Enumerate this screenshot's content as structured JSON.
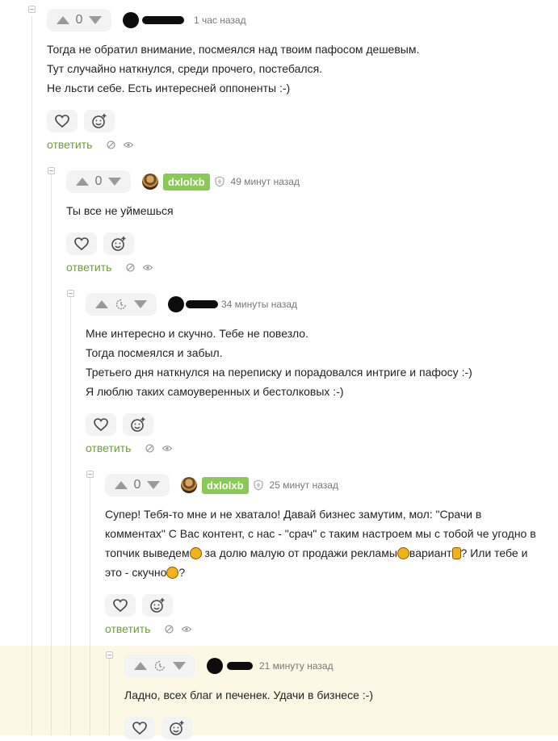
{
  "comments": [
    {
      "score": "0",
      "time": "1 час назад",
      "lines": [
        "Тогда не обратил внимание, посмеялся над твоим пафосом дешевым.",
        "Тут случайно наткнулся, среди прочего, постебался.",
        "Не льсти себе. Есть интересней оппоненты :-)"
      ],
      "reply": "ответить"
    },
    {
      "score": "0",
      "nick": "dxlolxb",
      "time": "49 минут назад",
      "lines": [
        "Ты все не уймешься"
      ],
      "reply": "ответить"
    },
    {
      "time": "34 минуты назад",
      "lines": [
        "Мне интересно и скучно. Тебе не повезло.",
        "Тогда посмеялся и забыл.",
        "Третьего дня наткнулся на переписку и порадовался интриге и пафосу :-)",
        "Я люблю таких самоуверенных и бестолковых :-)"
      ],
      "reply": "ответить"
    },
    {
      "score": "0",
      "nick": "dxlolxb",
      "time": "25 минут назад",
      "text_parts": [
        "Супер! Тебя-то мне и не хватало! Давай бизнес замутим, мол: \"Срачи в комментах\" С Вас контент, с нас - \"срач\" с таким настроем мы с тобой че угодно в топчик выведем",
        " за долю малую от продажи рекламы",
        "вариант",
        "? Или тебе и это - скучно",
        "?"
      ],
      "reply": "ответить"
    },
    {
      "time": "21 минуту назад",
      "lines": [
        "Ладно, всех благ и печенек. Удачи в бизнесе :-)"
      ]
    }
  ],
  "colors": {
    "accent_green": "#8ac858",
    "reply_green": "#6c9e3b",
    "highlight": "#fdf7e6"
  },
  "icons": [
    "arrow-up-icon",
    "arrow-down-icon",
    "clock-icon",
    "shield-icon",
    "heart-icon",
    "add-emoji-icon",
    "block-icon",
    "eye-icon"
  ]
}
